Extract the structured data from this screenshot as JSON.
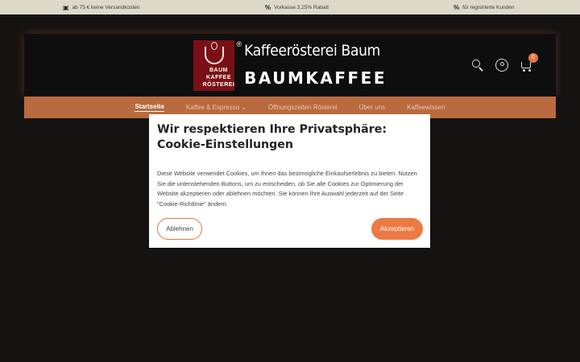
{
  "topbar": {
    "items": [
      {
        "icon": "box-icon",
        "glyph": "▣",
        "text": "ab 75 € keine Versandkosten"
      },
      {
        "icon": "percent-icon",
        "glyph": "%",
        "text": "Vorkasse 3,25% Rabatt"
      },
      {
        "icon": "percent-icon",
        "glyph": "%",
        "text": "für registrierte Kunden"
      }
    ]
  },
  "logo": {
    "line1": "Kaffeerösterei Baum",
    "line2": "BAUMKAFFEE",
    "mark_lines": [
      "BAUM",
      "KAFFEE",
      "RÖSTEREI"
    ],
    "reg": "®"
  },
  "header": {
    "cart_count": "0"
  },
  "nav": {
    "items": [
      "Startseite",
      "Kaffee & Espresso ⌄",
      "Öffnungszeiten Rösterei",
      "Über uns",
      "Kaffeewissen"
    ]
  },
  "cookie": {
    "title": "Wir respektieren Ihre Privatsphäre: Cookie-Einstellungen",
    "body": "Diese Website verwendet Cookies, um Ihnen das bestmögliche Einkaufserlebnis zu bieten. Nutzen Sie die untenstehenden Buttons, um zu entscheiden, ob Sie alle Cookies zur Optimierung der Website akzeptieren oder ablehnen möchten. Sie können Ihre Auswahl jederzeit auf der Seite \"Cookie-Richtlinie\" ändern.",
    "decline": "Ablehnen",
    "accept": "Akzeptieren"
  },
  "colors": {
    "accent": "#ec7a44",
    "nav_bg": "#b96a3f",
    "topbar_bg": "#ddd9c9"
  }
}
